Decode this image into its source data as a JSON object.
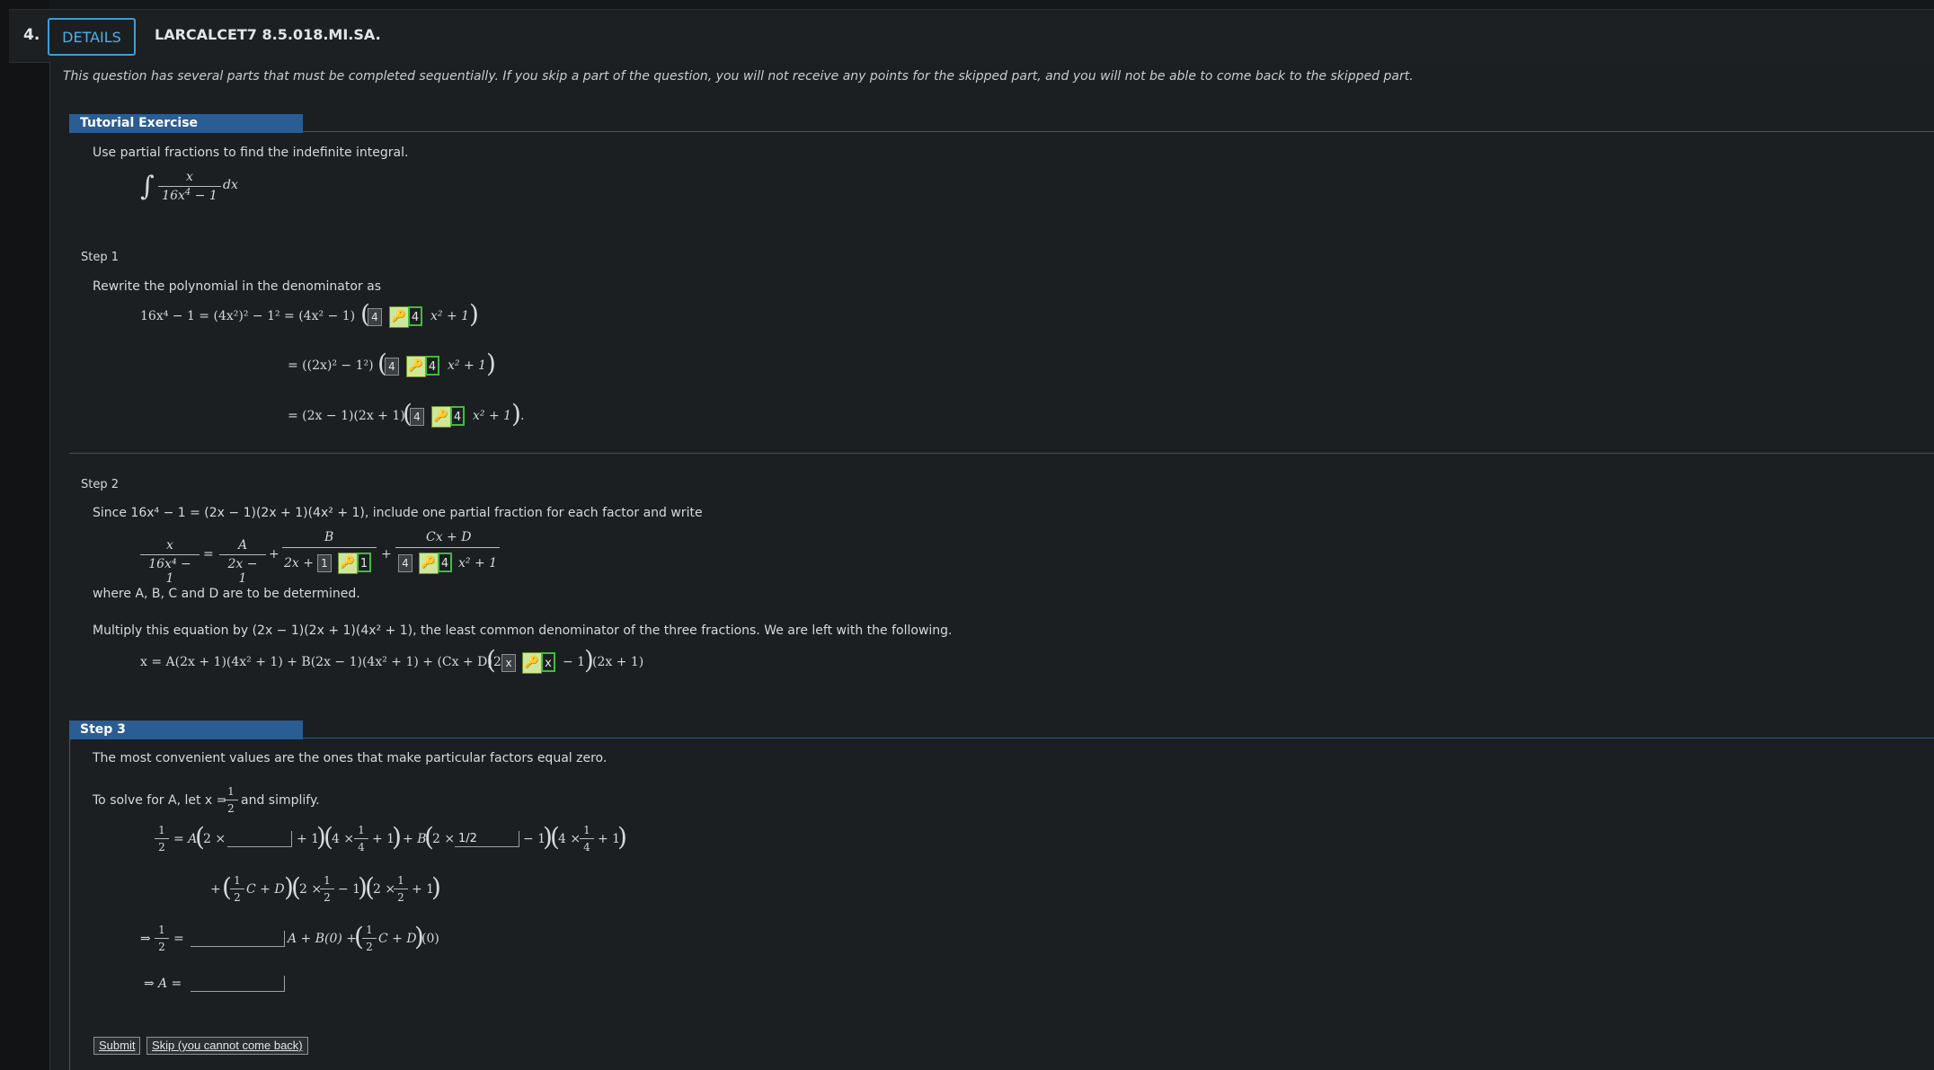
{
  "question": {
    "number": "4.",
    "details_label": "DETAILS",
    "code": "LARCALCET7 8.5.018.MI.SA."
  },
  "notice": "This question has several parts that must be completed sequentially. If you skip a part of the question, you will not receive any points for the skipped part, and you will not be able to come back to the skipped part.",
  "tutorial": {
    "header": "Tutorial Exercise",
    "instruction": "Use partial fractions to find the indefinite integral.",
    "integral": {
      "num": "x",
      "den_a": "16x",
      "den_exp": "4",
      "den_b": " − 1",
      "dx": "dx"
    }
  },
  "step1": {
    "title": "Step 1",
    "text": "Rewrite the polynomial in the denominator as",
    "line1": "16x⁴ − 1 = (4x²)² − 1² = (4x² − 1)",
    "line2": "= ((2x)² − 1²)",
    "line3": "= (2x − 1)(2x + 1)",
    "tail": "x² + 1",
    "period": ".",
    "gray_value": "4",
    "green_value": "4"
  },
  "step2": {
    "title": "Step 2",
    "since": "Since 16x⁴ − 1 = (2x − 1)(2x + 1)(4x² + 1), include one partial fraction for each factor and write",
    "frac_lhs_num": "x",
    "frac_lhs_den": "16x⁴ − 1",
    "frac_a_num": "A",
    "frac_a_den": "2x − 1",
    "frac_b_num": "B",
    "frac_b_den": "2x +",
    "frac_c_num": "Cx + D",
    "frac_c_den_tail": "x² + 1",
    "gray_b": "1",
    "green_b": "1",
    "gray_c": "4",
    "green_c": "4",
    "where": "where A, B, C and D are to be determined.",
    "multiply": "Multiply this equation by (2x − 1)(2x + 1)(4x² + 1), the least common denominator of the three fractions. We are left with the following.",
    "eq_start": "x = A(2x + 1)(4x² + 1) + B(2x − 1)(4x² + 1) + (Cx + D)",
    "eq_two": "2",
    "gray_x": "x",
    "green_x": "x",
    "eq_end": "− 1",
    "eq_tail": "(2x + 1)"
  },
  "step3": {
    "header": "Step 3",
    "convenient": "The most convenient values are the ones that make particular factors equal zero.",
    "solve_a": "To solve for A, let x =",
    "simplify": "and simplify.",
    "half_num": "1",
    "half_den": "2",
    "quarter_den": "4",
    "input_a1": "",
    "input_b1": "1/2",
    "input_coef": "",
    "input_A": "",
    "arrow": "⇒",
    "A_label": "A =",
    "rest": "A + B(0) +",
    "zero": "(0)"
  },
  "buttons": {
    "submit": "Submit",
    "skip": "Skip (you cannot come back)"
  },
  "colors": {
    "accent": "#2a5d93",
    "link": "#3a9ed8",
    "correct": "#3ebd3e"
  }
}
